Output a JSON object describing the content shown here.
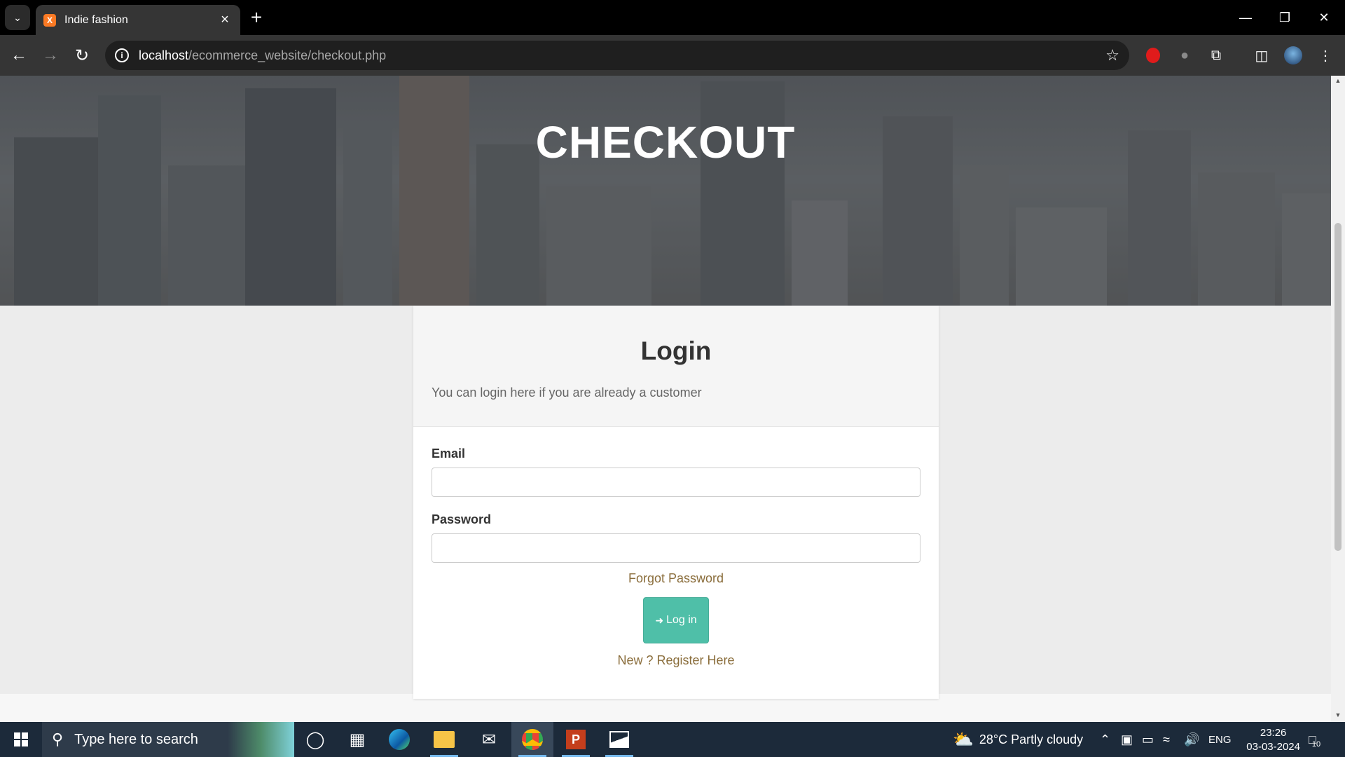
{
  "browser": {
    "tab_title": "Indie fashion",
    "favicon_text": "X",
    "url_host": "localhost",
    "url_path": "/ecommerce_website/checkout.php"
  },
  "hero": {
    "title": "CHECKOUT"
  },
  "login": {
    "title": "Login",
    "subtitle": "You can login here if you are already a customer",
    "email_label": "Email",
    "email_value": "",
    "password_label": "Password",
    "password_value": "",
    "forgot_link": "Forgot Password",
    "login_button": "Log in",
    "register_link": "New ? Register Here"
  },
  "taskbar": {
    "search_placeholder": "Type here to search",
    "weather": "28°C  Partly cloudy",
    "language": "ENG",
    "time": "23:26",
    "date": "03-03-2024",
    "notification_count": "10"
  },
  "colors": {
    "accent_button": "#4fbfa8",
    "link": "#8a6d3b",
    "taskbar": "#1c2a3a",
    "chrome_toolbar": "#353535"
  }
}
